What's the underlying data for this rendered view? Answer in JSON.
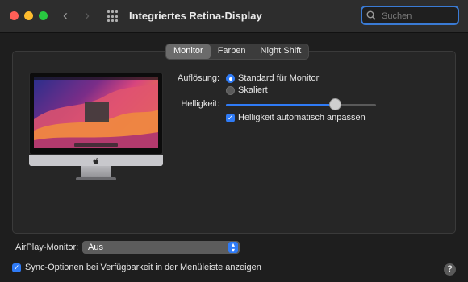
{
  "window": {
    "title": "Integriertes Retina-Display",
    "back_glyph": "‹",
    "forward_glyph": "›"
  },
  "search": {
    "placeholder": "Suchen",
    "value": ""
  },
  "tabs": [
    {
      "label": "Monitor",
      "active": true
    },
    {
      "label": "Farben",
      "active": false
    },
    {
      "label": "Night Shift",
      "active": false
    }
  ],
  "resolution": {
    "label": "Auflösung:",
    "options": [
      {
        "label": "Standard für Monitor",
        "selected": true
      },
      {
        "label": "Skaliert",
        "selected": false
      }
    ]
  },
  "brightness": {
    "label": "Helligkeit:",
    "level": 0.73,
    "auto_label": "Helligkeit automatisch anpassen",
    "auto_checked": true
  },
  "airplay": {
    "label": "AirPlay-Monitor:",
    "value": "Aus"
  },
  "sync_option": {
    "label": "Sync-Optionen bei Verfügbarkeit in der Menüleiste anzeigen",
    "checked": true
  },
  "help_label": "?",
  "colors": {
    "accent": "#2f7bf6",
    "background": "#1e1e1e",
    "panel": "#262626"
  },
  "icons": [
    "close-icon",
    "minimize-icon",
    "zoom-icon",
    "grid-icon",
    "search-icon",
    "apple-logo-icon",
    "chevron-updown-icon",
    "checkmark-icon"
  ]
}
